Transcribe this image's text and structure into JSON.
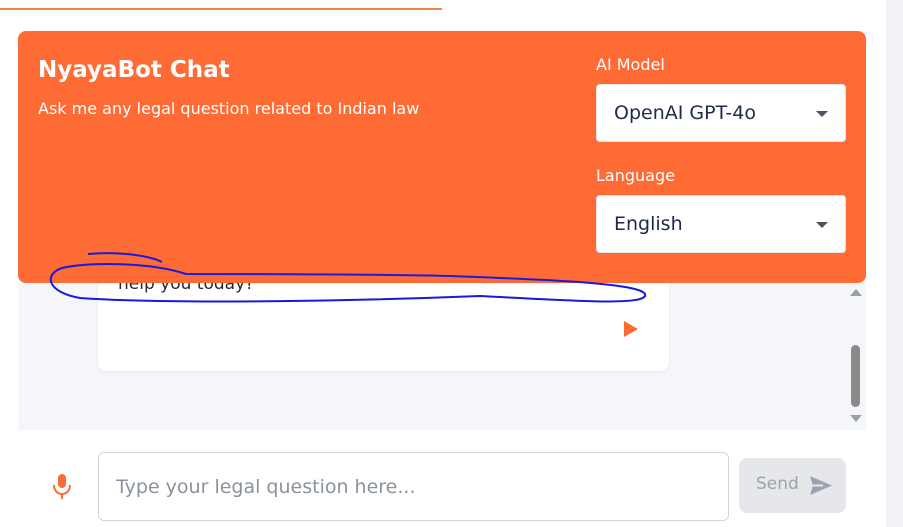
{
  "header": {
    "title": "NyayaBot Chat",
    "subtitle": "Ask me any legal question related to Indian law",
    "model_label": "AI Model",
    "model_value": "OpenAI GPT-4o",
    "language_label": "Language",
    "language_value": "English"
  },
  "chat": {
    "message_text": "help you today?"
  },
  "composer": {
    "placeholder": "Type your legal question here...",
    "send_label": "Send"
  },
  "colors": {
    "accent": "#ff6b35",
    "annotation": "#1a1adb"
  },
  "icons": {
    "play": "play-icon",
    "mic": "microphone-icon",
    "send": "send-arrow-icon",
    "dropdown": "chevron-down-icon"
  }
}
